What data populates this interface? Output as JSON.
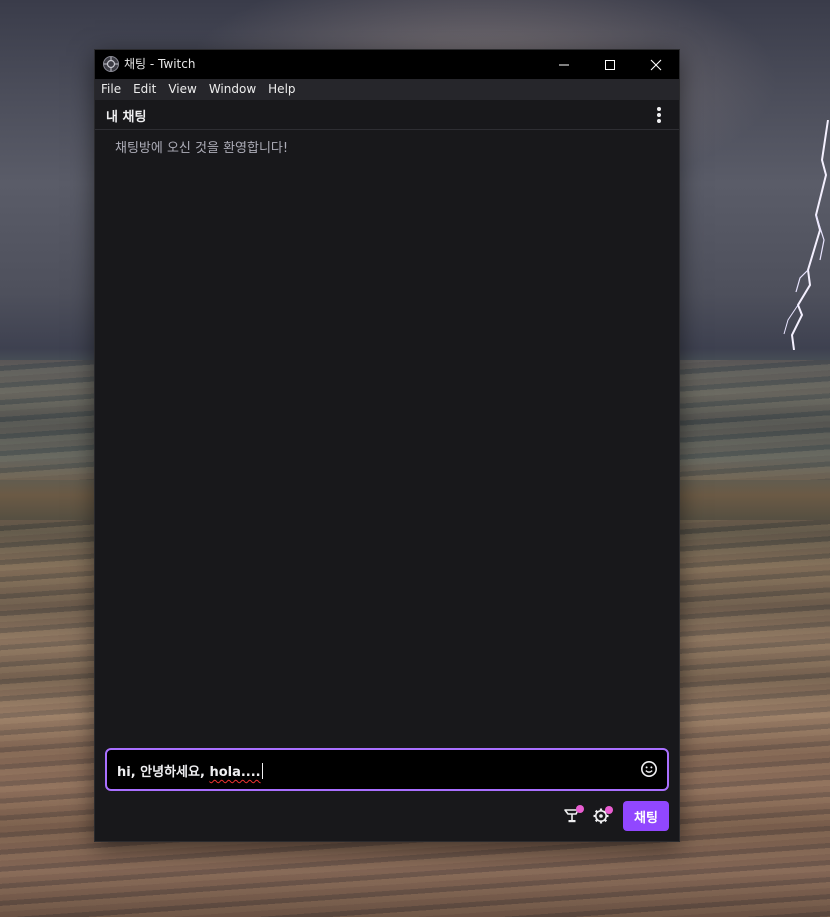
{
  "window": {
    "title": "채팅 - Twitch"
  },
  "menu": {
    "items": [
      {
        "label": "File"
      },
      {
        "label": "Edit"
      },
      {
        "label": "View"
      },
      {
        "label": "Window"
      },
      {
        "label": "Help"
      }
    ]
  },
  "chat": {
    "header_title": "내 채팅",
    "welcome_message": "채팅방에 오신 것을 환영합니다!",
    "input": {
      "value_prefix": "hi, 안녕하세요, ",
      "value_misspelled": "hola...."
    },
    "send_label": "채팅"
  },
  "icons": {
    "app": "twitch-app-icon",
    "minimize": "minimize-icon",
    "maximize": "maximize-icon",
    "close": "close-icon",
    "more": "more-vertical-icon",
    "emoji": "emoji-icon",
    "gift": "gift-icon",
    "settings": "gear-icon"
  },
  "colors": {
    "accent": "#9147ff",
    "input_border": "#a970ff",
    "notification_dot": "#e95ed2",
    "background": "#18181b"
  }
}
